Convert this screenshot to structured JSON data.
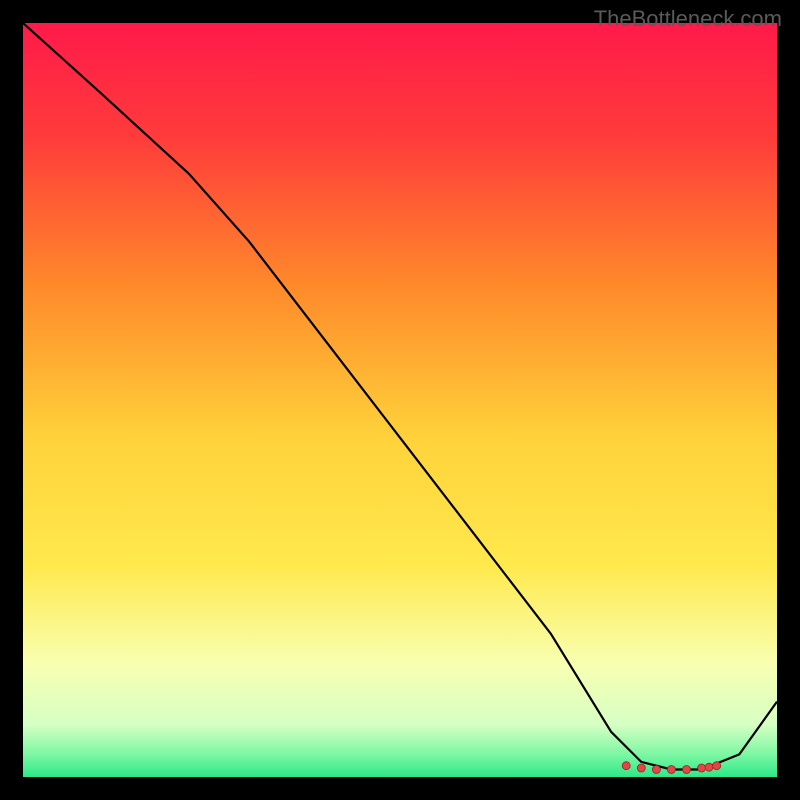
{
  "attribution": "TheBottleneck.com",
  "chart_data": {
    "type": "line",
    "title": "",
    "xlabel": "",
    "ylabel": "",
    "xlim": [
      0,
      100
    ],
    "ylim": [
      0,
      100
    ],
    "series": [
      {
        "name": "curve",
        "x": [
          0,
          10,
          22,
          30,
          40,
          50,
          60,
          70,
          78,
          82,
          86,
          90,
          95,
          100
        ],
        "y": [
          100,
          91,
          80,
          71,
          58,
          45,
          32,
          19,
          6,
          2,
          1,
          1,
          3,
          10
        ]
      }
    ],
    "markers": {
      "name": "min-region",
      "x": [
        80,
        82,
        84,
        86,
        88,
        90,
        91,
        92
      ],
      "y": [
        1.5,
        1.2,
        1.0,
        1.0,
        1.0,
        1.2,
        1.3,
        1.5
      ]
    },
    "gradient_stops": [
      {
        "offset": 0.0,
        "color": "#ff1a4a"
      },
      {
        "offset": 0.15,
        "color": "#ff3b3b"
      },
      {
        "offset": 0.35,
        "color": "#ff8a2a"
      },
      {
        "offset": 0.55,
        "color": "#ffd23a"
      },
      {
        "offset": 0.72,
        "color": "#ffe94d"
      },
      {
        "offset": 0.85,
        "color": "#f8ffb0"
      },
      {
        "offset": 0.93,
        "color": "#d7ffc4"
      },
      {
        "offset": 0.97,
        "color": "#7cf7a2"
      },
      {
        "offset": 1.0,
        "color": "#2ee88a"
      }
    ]
  }
}
